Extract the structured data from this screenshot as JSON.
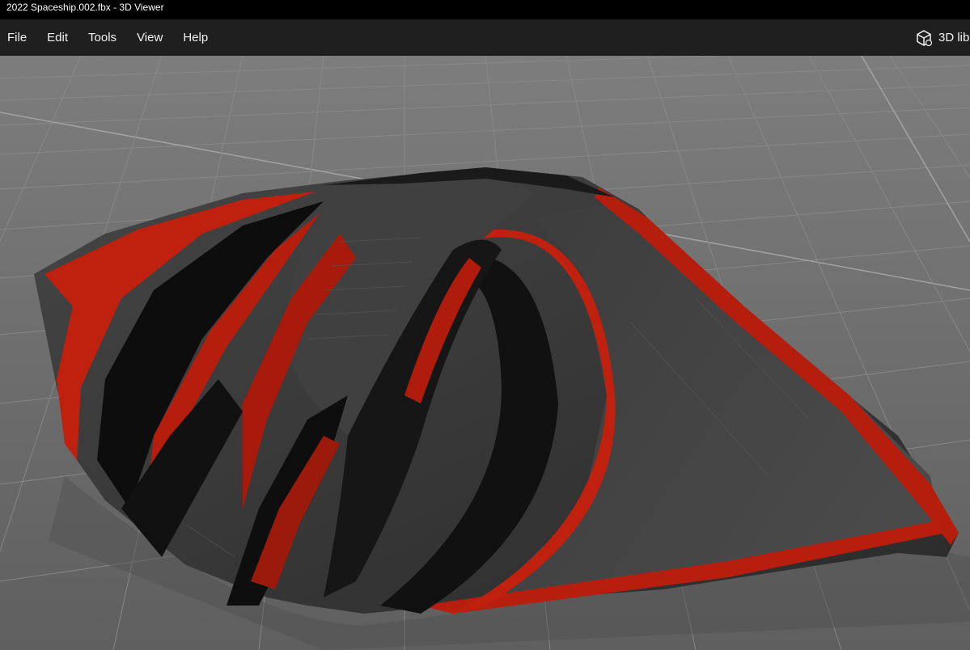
{
  "window": {
    "title": "2022 Spaceship.002.fbx - 3D Viewer"
  },
  "menu": {
    "items": [
      {
        "label": "File"
      },
      {
        "label": "Edit"
      },
      {
        "label": "Tools"
      },
      {
        "label": "View"
      },
      {
        "label": "Help"
      }
    ]
  },
  "library": {
    "label": "3D lib",
    "icon": "cube-icon"
  },
  "viewport": {
    "model_colors": {
      "body": "#3a3a3a",
      "accent": "#c0210f",
      "floor": "#707070",
      "grid": "#8e8e8e"
    }
  }
}
